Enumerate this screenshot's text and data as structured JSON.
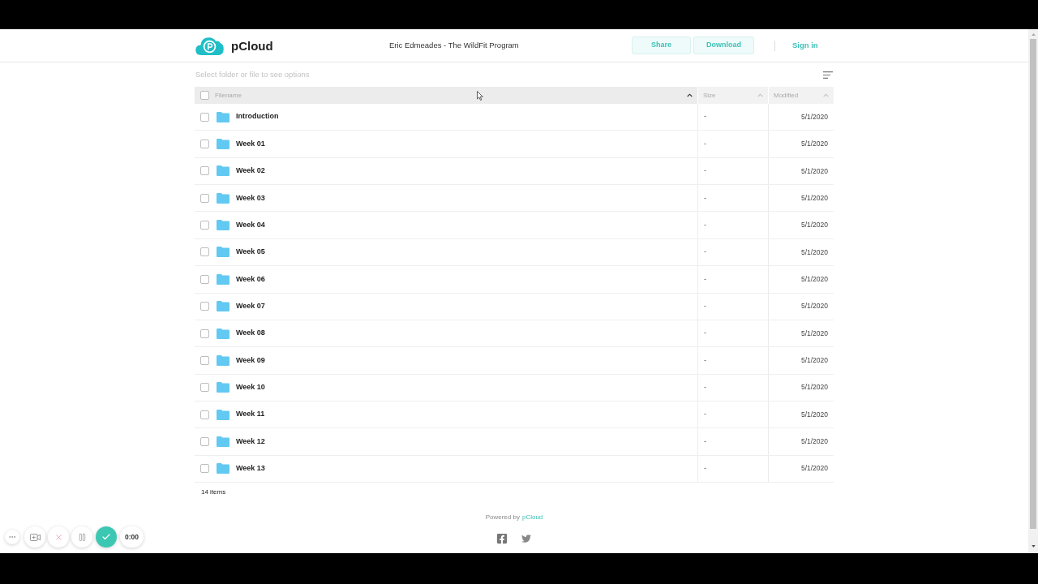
{
  "header": {
    "logo": "pCloud",
    "title": "Eric Edmeades - The WildFit Program",
    "actions": [
      {
        "label": "Share"
      },
      {
        "label": "Download"
      }
    ],
    "sign_in": "Sign in"
  },
  "hint": "Select folder or file to see options",
  "table": {
    "select_all": {
      "checked": false
    },
    "columns": [
      {
        "label": "Filename",
        "sorted": true
      },
      {
        "label": "Size",
        "sorted": false
      },
      {
        "label": "Modified",
        "sorted": false
      }
    ],
    "rows": [
      {
        "name": "Introduction",
        "size": "-",
        "modified": "5/1/2020",
        "checked": false
      },
      {
        "name": "Week 01",
        "size": "-",
        "modified": "5/1/2020",
        "checked": false
      },
      {
        "name": "Week 02",
        "size": "-",
        "modified": "5/1/2020",
        "checked": false
      },
      {
        "name": "Week 03",
        "size": "-",
        "modified": "5/1/2020",
        "checked": false
      },
      {
        "name": "Week 04",
        "size": "-",
        "modified": "5/1/2020",
        "checked": false
      },
      {
        "name": "Week 05",
        "size": "-",
        "modified": "5/1/2020",
        "checked": false
      },
      {
        "name": "Week 06",
        "size": "-",
        "modified": "5/1/2020",
        "checked": false
      },
      {
        "name": "Week 07",
        "size": "-",
        "modified": "5/1/2020",
        "checked": false
      },
      {
        "name": "Week 08",
        "size": "-",
        "modified": "5/1/2020",
        "checked": false
      },
      {
        "name": "Week 09",
        "size": "-",
        "modified": "5/1/2020",
        "checked": false
      },
      {
        "name": "Week 10",
        "size": "-",
        "modified": "5/1/2020",
        "checked": false
      },
      {
        "name": "Week 11",
        "size": "-",
        "modified": "5/1/2020",
        "checked": false
      },
      {
        "name": "Week 12",
        "size": "-",
        "modified": "5/1/2020",
        "checked": false
      },
      {
        "name": "Week 13",
        "size": "-",
        "modified": "5/1/2020",
        "checked": false
      }
    ]
  },
  "item_count": "14 items",
  "footer": {
    "powered_by": "Powered by",
    "link": "pCloud"
  },
  "recorder": {
    "timer": "0:00"
  }
}
